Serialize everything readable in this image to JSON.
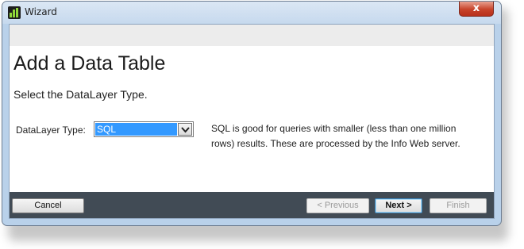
{
  "window": {
    "title": "Wizard",
    "close_glyph": "x"
  },
  "page": {
    "title": "Add a Data Table",
    "subtitle": "Select the DataLayer Type."
  },
  "form": {
    "datalayer_label": "DataLayer Type:",
    "datalayer_value": "SQL",
    "description": "SQL is good for queries with smaller (less than one million rows) results. These are processed by the Info Web server."
  },
  "buttons": {
    "cancel": "Cancel",
    "previous": "< Previous",
    "next": "Next >",
    "finish": "Finish"
  },
  "colors": {
    "selection": "#3399ff",
    "footer": "#414b55",
    "close": "#c7432a"
  }
}
